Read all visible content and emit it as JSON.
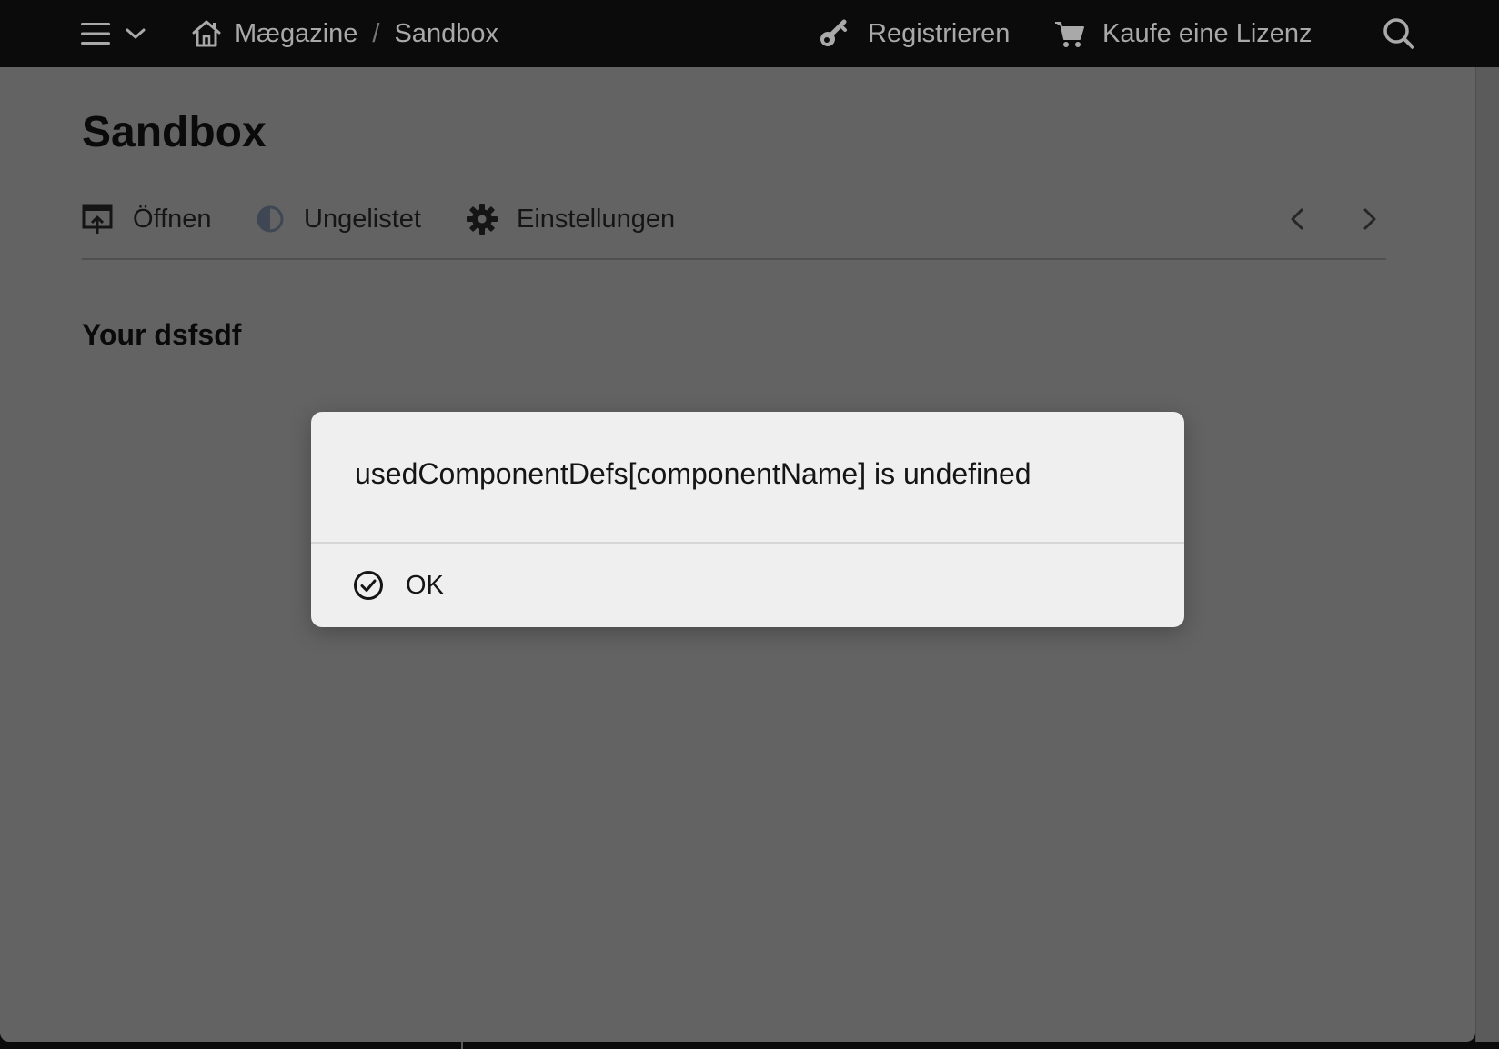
{
  "topbar": {
    "breadcrumb": {
      "home": "Mægazine",
      "separator": "/",
      "current": "Sandbox"
    },
    "register_label": "Registrieren",
    "buy_label": "Kaufe eine Lizenz",
    "icons": {
      "menu": "hamburger-icon",
      "menu_chevron": "chevron-down-icon",
      "home": "home-icon",
      "register": "key-icon",
      "buy": "cart-icon",
      "search": "search-icon"
    }
  },
  "main": {
    "title": "Sandbox",
    "toolbar": [
      {
        "label": "Öffnen",
        "icon": "open-icon"
      },
      {
        "label": "Ungelistet",
        "icon": "half-circle-icon"
      },
      {
        "label": "Einstellungen",
        "icon": "gear-icon"
      }
    ],
    "pager": {
      "prev_icon": "chevron-left-icon",
      "next_icon": "chevron-right-icon"
    },
    "section_heading": "Your dsfsdf"
  },
  "dialog": {
    "message": "usedComponentDefs[componentName] is undefined",
    "ok_label": "OK",
    "ok_icon": "check-circle-icon"
  },
  "colors": {
    "topbar_bg": "#0b0b0b",
    "overlay_bg": "#636363",
    "dialog_bg": "#efefef",
    "topbar_text": "#a9a9a9"
  }
}
